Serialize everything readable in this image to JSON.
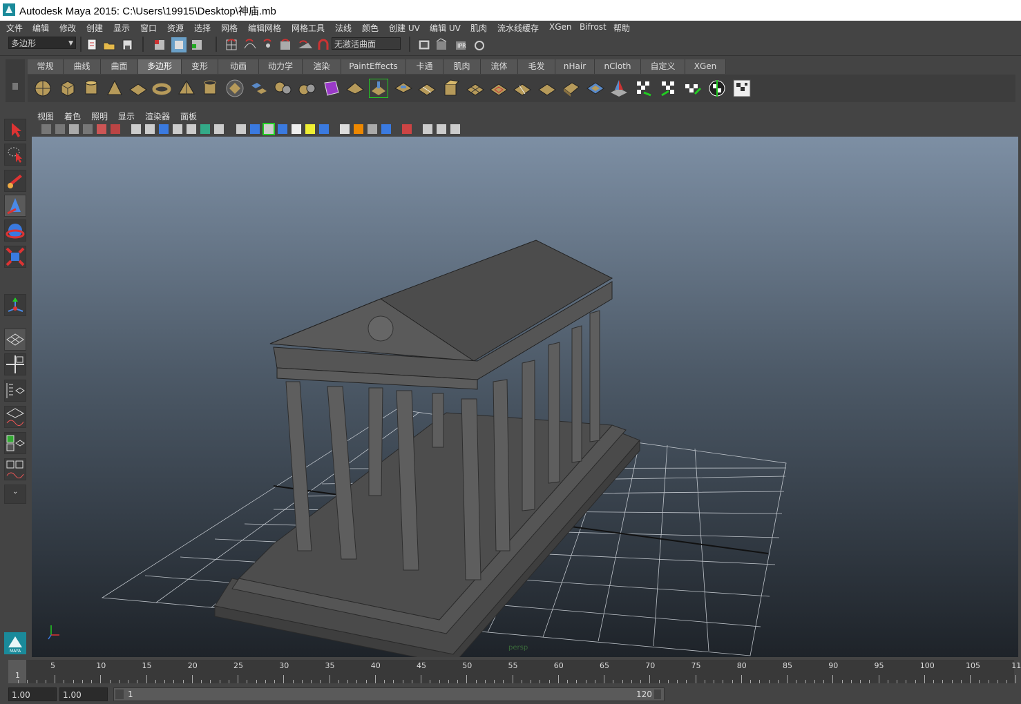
{
  "window": {
    "title": "Autodesk Maya 2015: C:\\Users\\19915\\Desktop\\神庙.mb"
  },
  "menubar": {
    "items": [
      "文件",
      "编辑",
      "修改",
      "创建",
      "显示",
      "窗口",
      "资源",
      "选择",
      "网格",
      "编辑网格",
      "网格工具",
      "法线",
      "颜色",
      "创建 UV",
      "编辑 UV",
      "肌肉",
      "流水线缓存",
      "XGen",
      "Bifrost",
      "帮助"
    ]
  },
  "statusline": {
    "mode": "多边形",
    "live_surface": "无激活曲面"
  },
  "shelf": {
    "tabs": [
      "常规",
      "曲线",
      "曲面",
      "多边形",
      "变形",
      "动画",
      "动力学",
      "渲染",
      "PaintEffects",
      "卡通",
      "肌肉",
      "流体",
      "毛发",
      "nHair",
      "nCloth",
      "自定义",
      "XGen"
    ],
    "active_tab": "多边形"
  },
  "panel": {
    "menus": [
      "视图",
      "着色",
      "照明",
      "显示",
      "渲染器",
      "面板"
    ],
    "camera": "persp"
  },
  "toolbox": {
    "logo_text": "MAYA"
  },
  "timeline": {
    "ticks": [
      "1",
      "5",
      "10",
      "15",
      "20",
      "25",
      "30",
      "35",
      "40",
      "45",
      "50",
      "55",
      "60",
      "65",
      "70",
      "75",
      "80",
      "85",
      "90",
      "95",
      "100",
      "105",
      "11"
    ]
  },
  "range": {
    "start": "1.00",
    "playback_start": "1.00",
    "slider_start": "1",
    "slider_end": "120"
  },
  "colors": {
    "accent": "#1a8a9a",
    "viewport_top": "#7d8fa4",
    "viewport_bottom": "#1e2329"
  }
}
